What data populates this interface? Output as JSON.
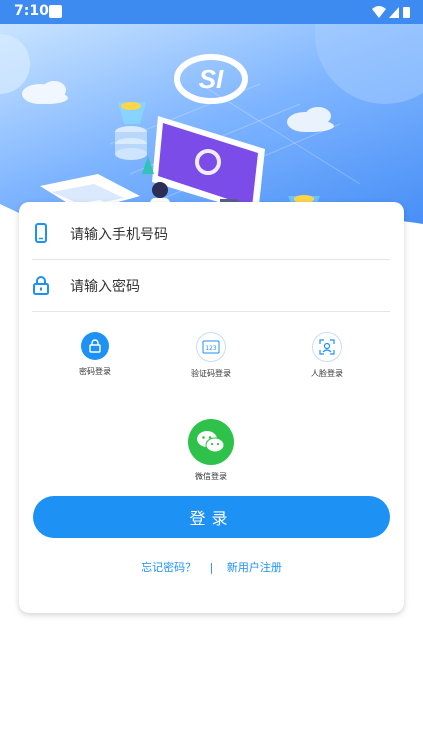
{
  "status_bar": {
    "time": "7:10"
  },
  "colors": {
    "primary": "#1e91f5",
    "wechat": "#2ec24a",
    "header_blue": "#3d8bf0"
  },
  "header": {
    "logo_text": "SI"
  },
  "form": {
    "phone_placeholder": "请输入手机号码",
    "password_placeholder": "请输入密码"
  },
  "login_methods": [
    {
      "label": "密码登录",
      "icon": "lock-icon",
      "active": true
    },
    {
      "label": "验证码登录",
      "icon": "code-123-icon",
      "active": false
    },
    {
      "label": "人脸登录",
      "icon": "face-scan-icon",
      "active": false
    }
  ],
  "wechat": {
    "label": "微信登录",
    "icon": "wechat-icon"
  },
  "login_button": {
    "label": "登录"
  },
  "links": {
    "forgot": "忘记密码？",
    "separator": "|",
    "register": "新用户注册"
  }
}
